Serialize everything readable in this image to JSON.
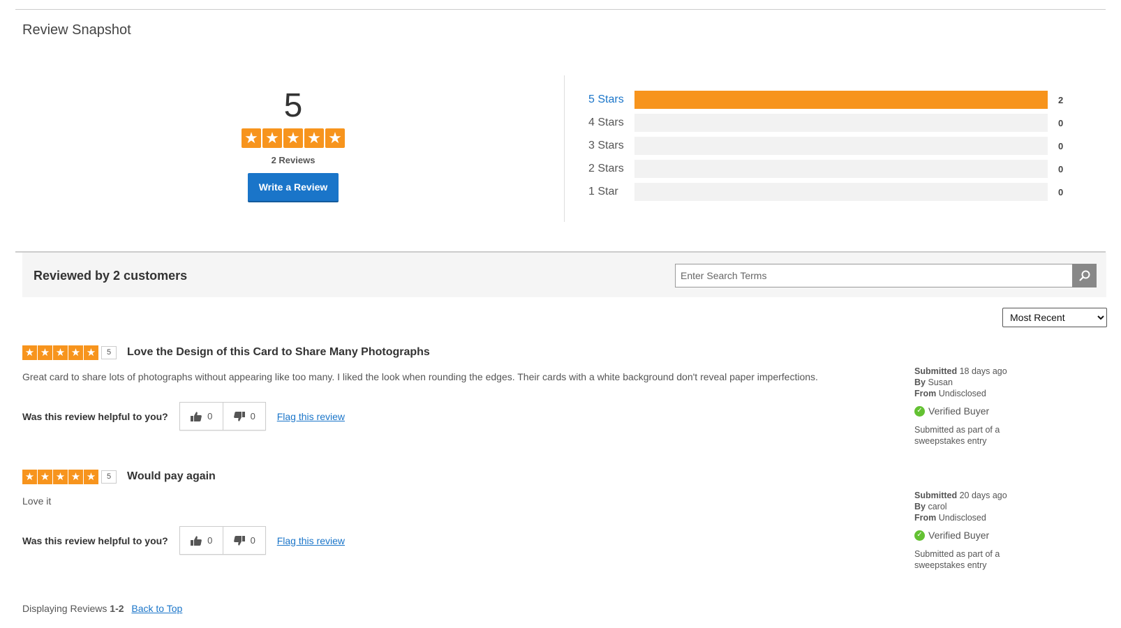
{
  "snapshot": {
    "title": "Review Snapshot",
    "average": "5",
    "average_rating_fraction": 1.0,
    "review_count": "2 Reviews",
    "write_review_label": "Write a Review"
  },
  "histogram": [
    {
      "label": "5 Stars",
      "count": "2",
      "fraction": 1.0
    },
    {
      "label": "4 Stars",
      "count": "0",
      "fraction": 0
    },
    {
      "label": "3 Stars",
      "count": "0",
      "fraction": 0
    },
    {
      "label": "2 Stars",
      "count": "0",
      "fraction": 0
    },
    {
      "label": "1 Star",
      "count": "0",
      "fraction": 0
    }
  ],
  "reviews_header": {
    "heading": "Reviewed by 2 customers",
    "search_placeholder": "Enter Search Terms",
    "sort_selected": "Most Recent"
  },
  "reviews": [
    {
      "rating": "5",
      "title": "Love the Design of this Card to Share Many Photographs",
      "body": "Great card to share lots of photographs without appearing like too many. I liked the look when rounding the edges. Their cards with a white background don't reveal paper imperfections.",
      "helpful_question": "Was this review helpful to you?",
      "upvotes": "0",
      "downvotes": "0",
      "flag_label": "Flag this review",
      "submitted_label": "Submitted",
      "submitted_value": "18 days ago",
      "by_label": "By",
      "by_value": "Susan",
      "from_label": "From",
      "from_value": "Undisclosed",
      "verified": "Verified Buyer",
      "sweepstakes": "Submitted as part of a sweepstakes entry"
    },
    {
      "rating": "5",
      "title": "Would pay again",
      "body": "Love it",
      "helpful_question": "Was this review helpful to you?",
      "upvotes": "0",
      "downvotes": "0",
      "flag_label": "Flag this review",
      "submitted_label": "Submitted",
      "submitted_value": "20 days ago",
      "by_label": "By",
      "by_value": "carol",
      "from_label": "From",
      "from_value": "Undisclosed",
      "verified": "Verified Buyer",
      "sweepstakes": "Submitted as part of a sweepstakes entry"
    }
  ],
  "footer": {
    "displaying_label": "Displaying Reviews",
    "range": "1-2",
    "back_to_top": "Back to Top"
  },
  "colors": {
    "accent": "#1a75c9",
    "star": "#f7941d",
    "verified": "#63c132"
  },
  "icons": {
    "star": "star-icon",
    "search": "search-icon",
    "thumbs_up": "thumbs-up-icon",
    "thumbs_down": "thumbs-down-icon",
    "check": "check-circle-icon"
  }
}
